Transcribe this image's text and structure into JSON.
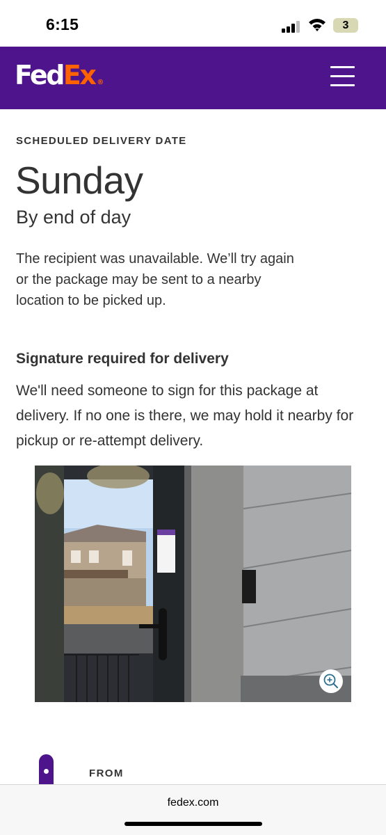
{
  "status_bar": {
    "time": "6:15",
    "battery_level": "3"
  },
  "header": {
    "logo_part1": "Fed",
    "logo_part2": "Ex",
    "logo_mark": "®",
    "menu_icon": "hamburger-menu-icon",
    "brand_color": "#4d148c",
    "accent_color": "#ff6200"
  },
  "delivery": {
    "eyebrow": "SCHEDULED DELIVERY DATE",
    "day": "Sunday",
    "time_window": "By end of day",
    "notice": "The recipient was unavailable. We’ll try again or the package may be sent to a nearby location to be picked up."
  },
  "signature": {
    "title": "Signature required for delivery",
    "body": "We'll need someone to sign for this package at delivery. If no one is there, we may hold it nearby for pickup or re-attempt delivery."
  },
  "photo": {
    "icon": "zoom-in-icon"
  },
  "from": {
    "label": "FROM"
  },
  "browser": {
    "url": "fedex.com"
  }
}
